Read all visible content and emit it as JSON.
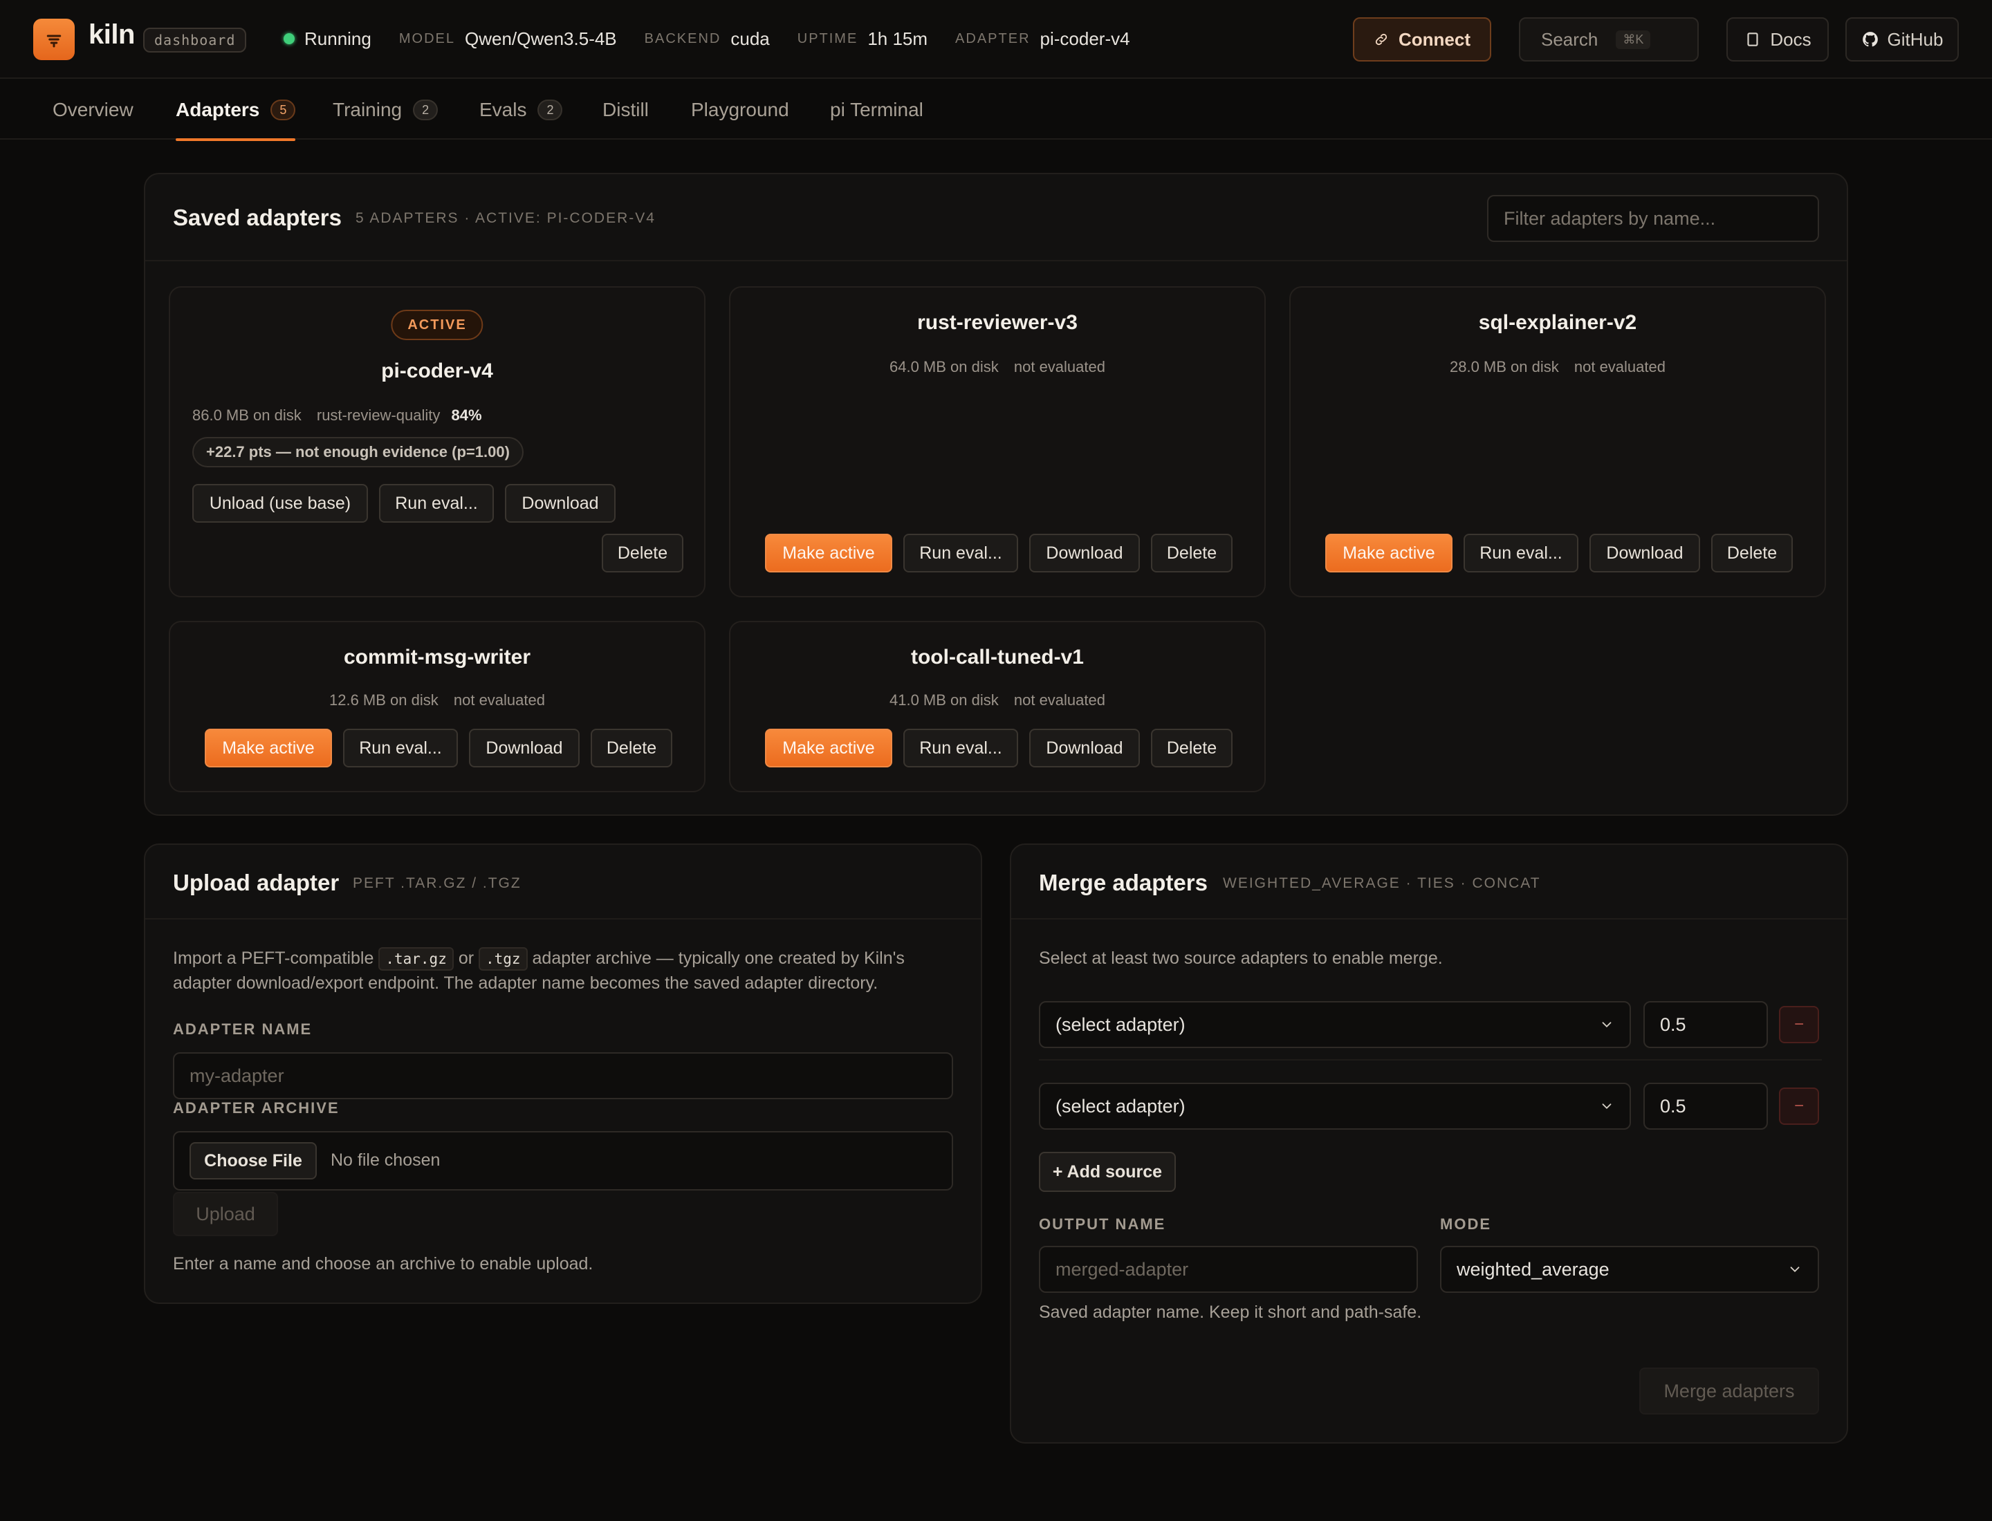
{
  "header": {
    "brand": "kiln",
    "brand_tag": "dashboard",
    "status": "Running",
    "model_label": "MODEL",
    "model_value": "Qwen/Qwen3.5-4B",
    "backend_label": "BACKEND",
    "backend_value": "cuda",
    "uptime_label": "UPTIME",
    "uptime_value": "1h 15m",
    "adapter_label": "ADAPTER",
    "adapter_value": "pi-coder-v4",
    "connect_label": "Connect",
    "search_label": "Search",
    "search_kbd": "⌘K",
    "docs_label": "Docs",
    "github_label": "GitHub"
  },
  "tabs": [
    {
      "label": "Overview",
      "badge": ""
    },
    {
      "label": "Adapters",
      "badge": "5"
    },
    {
      "label": "Training",
      "badge": "2"
    },
    {
      "label": "Evals",
      "badge": "2"
    },
    {
      "label": "Distill",
      "badge": ""
    },
    {
      "label": "Playground",
      "badge": ""
    },
    {
      "label": "pi Terminal",
      "badge": ""
    }
  ],
  "saved": {
    "title": "Saved adapters",
    "subtitle": "5 adapters · active: pi-coder-v4",
    "filter_placeholder": "Filter adapters by name..."
  },
  "adapters": [
    {
      "name": "pi-coder-v4",
      "badge": "ACTIVE",
      "size": "86.0 MB on disk",
      "eval_name": "rust-review-quality",
      "eval_score": "84%",
      "delta": "+22.7 pts — not enough evidence (p=1.00)",
      "actions": [
        "Unload (use base)",
        "Run eval...",
        "Download",
        "Delete"
      ]
    },
    {
      "name": "rust-reviewer-v3",
      "size": "64.0 MB on disk",
      "eval_status": "not evaluated",
      "actions": [
        "Make active",
        "Run eval...",
        "Download",
        "Delete"
      ]
    },
    {
      "name": "sql-explainer-v2",
      "size": "28.0 MB on disk",
      "eval_status": "not evaluated",
      "actions": [
        "Make active",
        "Run eval...",
        "Download",
        "Delete"
      ]
    },
    {
      "name": "commit-msg-writer",
      "size": "12.6 MB on disk",
      "eval_status": "not evaluated",
      "actions": [
        "Make active",
        "Run eval...",
        "Download",
        "Delete"
      ]
    },
    {
      "name": "tool-call-tuned-v1",
      "size": "41.0 MB on disk",
      "eval_status": "not evaluated",
      "actions": [
        "Make active",
        "Run eval...",
        "Download",
        "Delete"
      ]
    }
  ],
  "upload": {
    "title": "Upload adapter",
    "subtitle": "PEFT .tar.gz / .tgz",
    "desc_a": "Import a PEFT-compatible",
    "desc_code1": ".tar.gz",
    "desc_or": "or",
    "desc_code2": ".tgz",
    "desc_b": "adapter archive — typically one created by Kiln's adapter download/export endpoint. The adapter name becomes the saved adapter directory.",
    "name_label": "ADAPTER NAME",
    "name_placeholder": "my-adapter",
    "archive_label": "ADAPTER ARCHIVE",
    "choose_file": "Choose File",
    "no_file": "No file chosen",
    "upload_btn": "Upload",
    "hint": "Enter a name and choose an archive to enable upload."
  },
  "merge": {
    "title": "Merge adapters",
    "subtitle": "weighted_average · ties · concat",
    "desc": "Select at least two source adapters to enable merge.",
    "sources": [
      {
        "adapter": "(select adapter)",
        "weight": "0.5",
        "remove": "−"
      },
      {
        "adapter": "(select adapter)",
        "weight": "0.5",
        "remove": "−"
      }
    ],
    "add_source": "+ Add source",
    "output_label": "OUTPUT NAME",
    "output_placeholder": "merged-adapter",
    "mode_label": "MODE",
    "mode_value": "weighted_average",
    "output_hint": "Saved adapter name. Keep it short and path-safe.",
    "merge_btn": "Merge adapters"
  }
}
